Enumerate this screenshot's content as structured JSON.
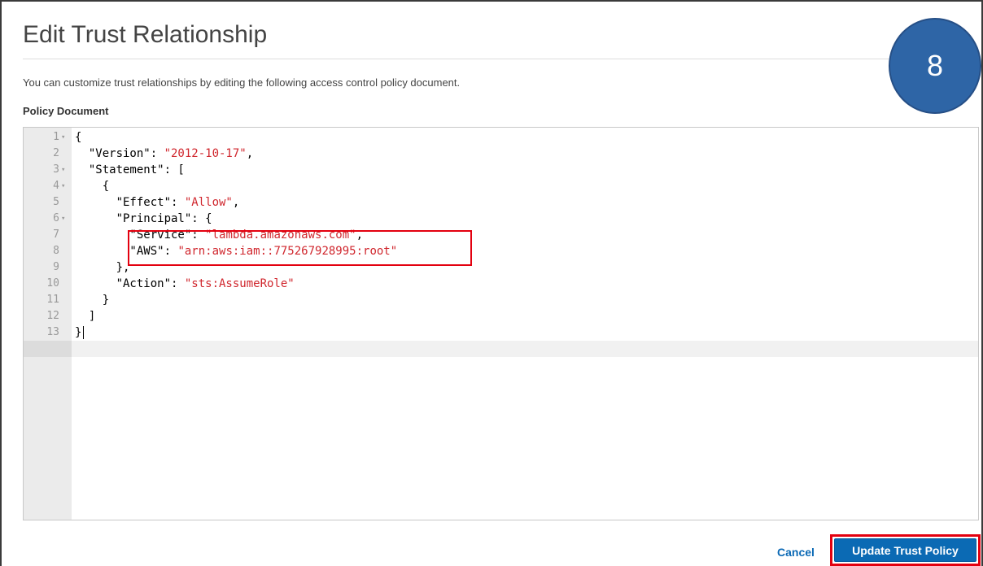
{
  "dialog": {
    "title": "Edit Trust Relationship",
    "description": "You can customize trust relationships by editing the following access control policy document.",
    "section_label": "Policy Document"
  },
  "editor": {
    "lines": [
      {
        "n": "1",
        "fold": "▾",
        "key": "{",
        "val": "",
        "tail": ""
      },
      {
        "n": "2",
        "fold": "",
        "key": "  \"Version\": ",
        "val": "\"2012-10-17\"",
        "tail": ","
      },
      {
        "n": "3",
        "fold": "▾",
        "key": "  \"Statement\": [",
        "val": "",
        "tail": ""
      },
      {
        "n": "4",
        "fold": "▾",
        "key": "    {",
        "val": "",
        "tail": ""
      },
      {
        "n": "5",
        "fold": "",
        "key": "      \"Effect\": ",
        "val": "\"Allow\"",
        "tail": ","
      },
      {
        "n": "6",
        "fold": "▾",
        "key": "      \"Principal\": {",
        "val": "",
        "tail": ""
      },
      {
        "n": "7",
        "fold": "",
        "key": "        \"Service\": ",
        "val": "\"lambda.amazonaws.com\"",
        "tail": ","
      },
      {
        "n": "8",
        "fold": "",
        "key": "        \"AWS\": ",
        "val": "\"arn:aws:iam::775267928995:root\"",
        "tail": ""
      },
      {
        "n": "9",
        "fold": "",
        "key": "      },",
        "val": "",
        "tail": ""
      },
      {
        "n": "10",
        "fold": "",
        "key": "      \"Action\": ",
        "val": "\"sts:AssumeRole\"",
        "tail": ""
      },
      {
        "n": "11",
        "fold": "",
        "key": "    }",
        "val": "",
        "tail": ""
      },
      {
        "n": "12",
        "fold": "",
        "key": "  ]",
        "val": "",
        "tail": ""
      },
      {
        "n": "13",
        "fold": "",
        "key": "}",
        "val": "",
        "tail": ""
      }
    ]
  },
  "step_badge": "8",
  "footer": {
    "cancel_label": "Cancel",
    "update_label": "Update Trust Policy"
  },
  "colors": {
    "accent": "#0b6ab4",
    "string": "#d0262d",
    "highlight": "#e3000f",
    "badge": "#2e65a6"
  }
}
